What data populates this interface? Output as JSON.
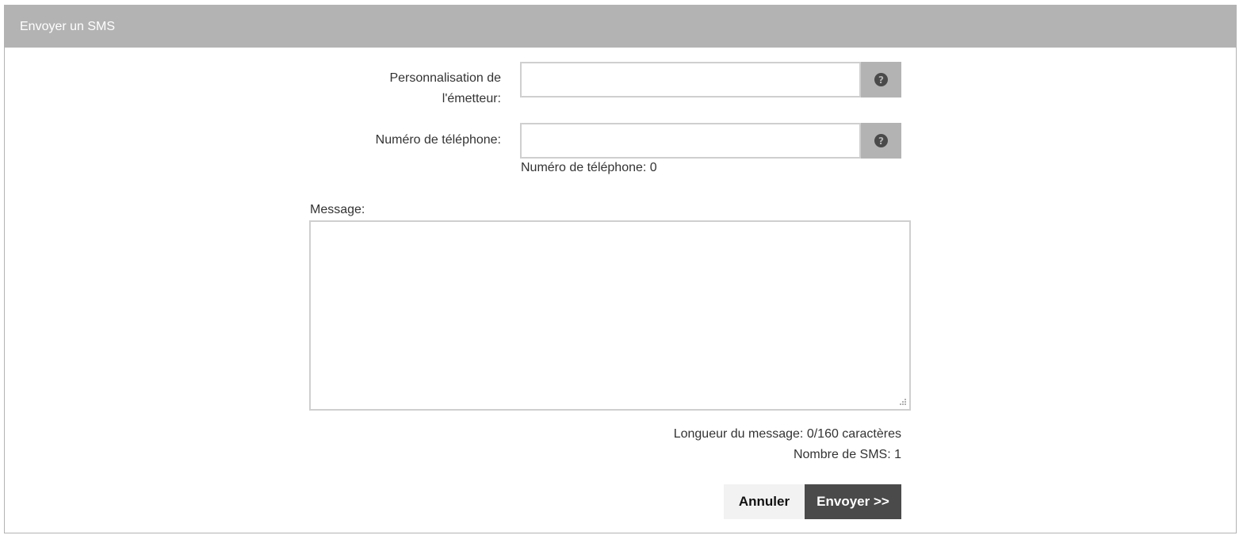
{
  "panel": {
    "title": "Envoyer un SMS"
  },
  "form": {
    "sender": {
      "label_line1": "Personnalisation de",
      "label_line2": "l'émetteur:",
      "value": "",
      "help_icon": "question-circle-icon"
    },
    "phone": {
      "label": "Numéro de téléphone:",
      "value": "",
      "help_icon": "question-circle-icon",
      "count_text": "Numéro de téléphone: 0"
    },
    "message": {
      "label": "Message:",
      "value": "",
      "length_text": "Longueur du message: 0/160 caractères",
      "sms_count_text": "Nombre de SMS: 1"
    }
  },
  "actions": {
    "cancel_label": "Annuler",
    "send_label": "Envoyer >>"
  },
  "colors": {
    "header_bg": "#b3b3b3",
    "send_bg": "#4a4a4a",
    "cancel_bg": "#f2f2f2"
  }
}
